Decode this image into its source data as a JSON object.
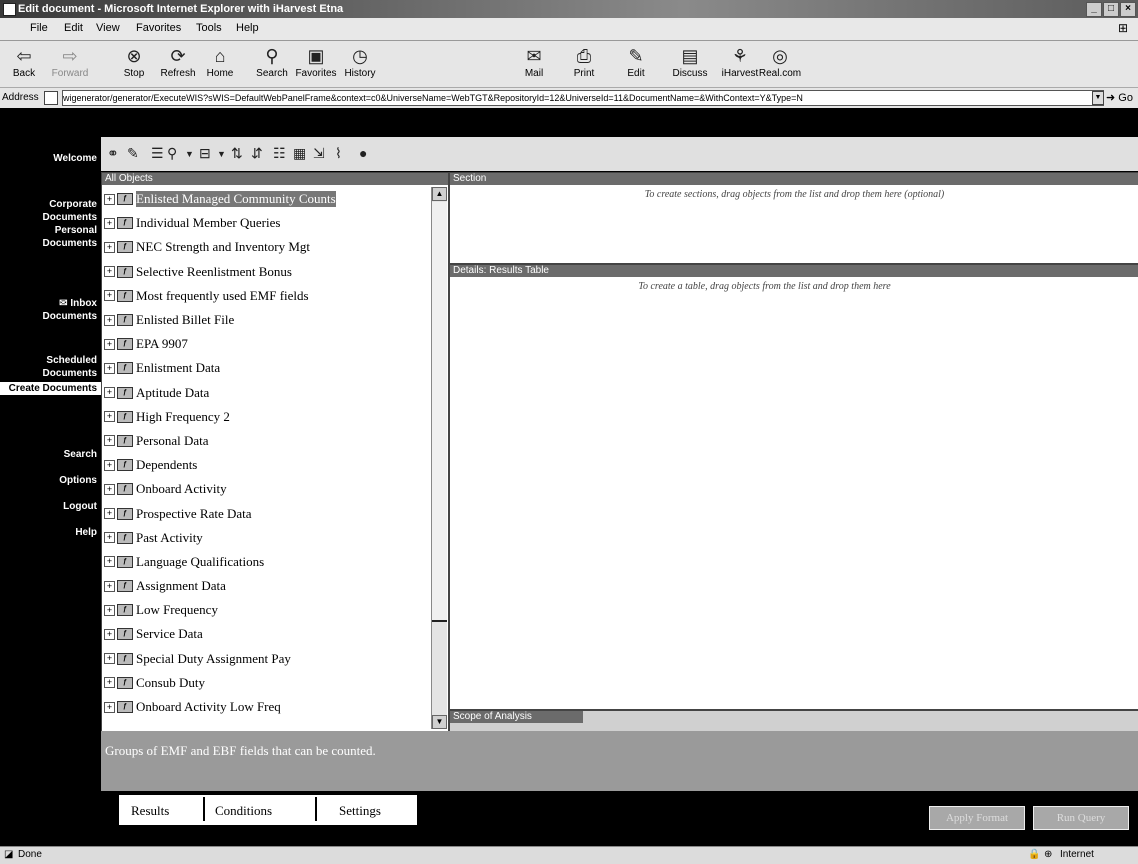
{
  "window": {
    "title": "Edit document - Microsoft Internet Explorer with iHarvest Etna"
  },
  "menu": [
    "File",
    "Edit",
    "View",
    "Favorites",
    "Tools",
    "Help"
  ],
  "toolbar": {
    "buttons": [
      {
        "label": "Back",
        "icon": "back-arrow-icon"
      },
      {
        "label": "Forward",
        "icon": "forward-arrow-icon"
      },
      {
        "label": "Stop",
        "icon": "stop-icon"
      },
      {
        "label": "Refresh",
        "icon": "refresh-icon"
      },
      {
        "label": "Home",
        "icon": "home-icon"
      },
      {
        "label": "Search",
        "icon": "search-icon"
      },
      {
        "label": "Favorites",
        "icon": "favorites-icon"
      },
      {
        "label": "History",
        "icon": "history-icon"
      },
      {
        "label": "Mail",
        "icon": "mail-icon"
      },
      {
        "label": "Print",
        "icon": "print-icon"
      },
      {
        "label": "Edit",
        "icon": "edit-icon"
      },
      {
        "label": "Discuss",
        "icon": "discuss-icon"
      },
      {
        "label": "iHarvest",
        "icon": "iharvest-icon"
      },
      {
        "label": "Real.com",
        "icon": "realcom-icon"
      }
    ]
  },
  "address": {
    "label": "Address",
    "url": "wigenerator/generator/ExecuteWIS?sWIS=DefaultWebPanelFrame&context=c0&UniverseName=WebTGT&RepositoryId=12&UniverseId=11&DocumentName=&WithContext=Y&Type=N",
    "go_label": "Go"
  },
  "nav": [
    {
      "label": "Welcome"
    },
    {
      "label": "Corporate Documents"
    },
    {
      "label": "Personal Documents"
    },
    {
      "label": "Inbox Documents"
    },
    {
      "label": "Scheduled Documents"
    },
    {
      "label": "Create Documents",
      "active": true
    },
    {
      "label": "Search"
    },
    {
      "label": "Options"
    },
    {
      "label": "Logout"
    },
    {
      "label": "Help"
    }
  ],
  "objects": {
    "header": "All Objects",
    "items": [
      "Enlisted Managed Community Counts",
      "Individual Member Queries",
      "NEC Strength and Inventory Mgt",
      "Selective Reenlistment Bonus",
      "Most frequently used EMF fields",
      "Enlisted Billet File",
      "EPA 9907",
      "Enlistment Data",
      "Aptitude Data",
      "High Frequency 2",
      "Personal Data",
      "Dependents",
      "Onboard Activity",
      "Prospective Rate Data",
      "Past Activity",
      "Language Qualifications",
      "Assignment Data",
      "Low Frequency",
      "Service Data",
      "Special Duty Assignment Pay",
      "Consub Duty",
      "Onboard Activity Low Freq"
    ]
  },
  "section": {
    "header": "Section",
    "hint": "To create sections, drag objects from the list and drop them here (optional)"
  },
  "details": {
    "header": "Details: Results Table",
    "hint": "To create a table, drag objects from the list and drop them here"
  },
  "scope": {
    "header": "Scope of Analysis"
  },
  "description": "Groups of EMF and EBF fields that can be counted.",
  "tabs": [
    "Results",
    "Conditions",
    "Settings"
  ],
  "actions": {
    "apply": "Apply Format",
    "run": "Run Query"
  },
  "status": {
    "left": "Done",
    "zone": "Internet"
  }
}
